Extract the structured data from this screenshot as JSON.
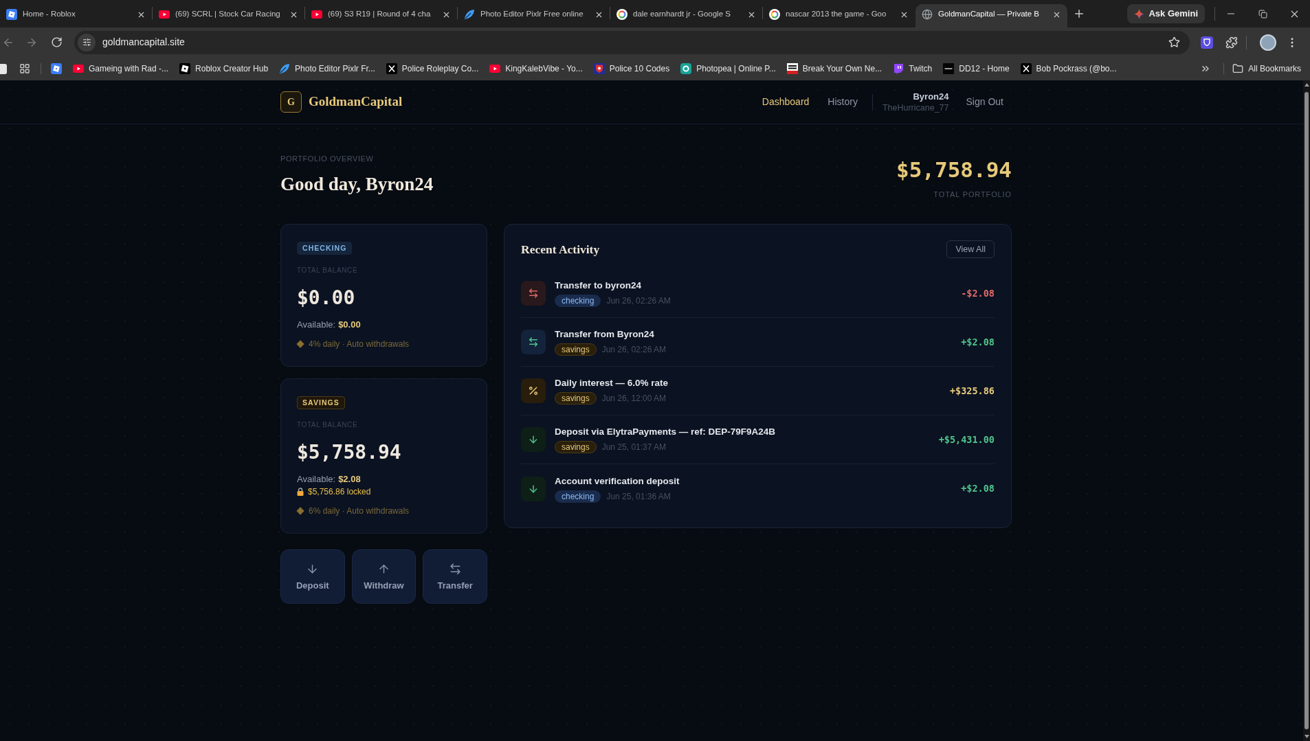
{
  "browser": {
    "tabs": [
      {
        "kind": "square",
        "title": "Home - Roblox",
        "selected": false
      },
      {
        "kind": "play",
        "title": "(69) SCRL | Stock Car Racing",
        "selected": false
      },
      {
        "kind": "play",
        "title": "(69) S3 R19 | Round of 4 cha",
        "selected": false
      },
      {
        "kind": "leaf",
        "title": "Photo Editor Pixlr Free online",
        "selected": false
      },
      {
        "kind": "ring",
        "title": "dale earnhardt jr - Google S",
        "selected": false
      },
      {
        "kind": "ring",
        "title": "nascar 2013 the game - Goo",
        "selected": false
      },
      {
        "kind": "globe",
        "title": "GoldmanCapital — Private B",
        "selected": true
      }
    ],
    "gemini_button": "Ask Gemini",
    "address": "goldmancapital.site",
    "bookmarks": [
      {
        "kind": "square"
      },
      {
        "kind": "play",
        "label": "Gameing with Rad -..."
      },
      {
        "kind": "tilted",
        "label": "Roblox Creator Hub"
      },
      {
        "kind": "leaf",
        "label": "Photo Editor Pixlr Fr..."
      },
      {
        "kind": "x",
        "label": "Police Roleplay Co..."
      },
      {
        "kind": "play",
        "label": "KingKalebVibe - Yo..."
      },
      {
        "kind": "emblem",
        "label": "Police 10 Codes"
      },
      {
        "kind": "ringtile",
        "label": "Photopea | Online P..."
      },
      {
        "kind": "news",
        "label": "Break Your Own Ne..."
      },
      {
        "kind": "bubble",
        "label": "Twitch"
      },
      {
        "kind": "tile",
        "label": "DD12 - Home"
      },
      {
        "kind": "x",
        "label": "Bob Pockrass (@bo..."
      }
    ],
    "all_bookmarks": "All Bookmarks"
  },
  "header": {
    "logo_letter": "G",
    "brand": "GoldmanCapital",
    "nav": [
      {
        "label": "Dashboard",
        "selected": true
      },
      {
        "label": "History",
        "selected": false
      }
    ],
    "user": {
      "name": "Byron24",
      "handle": "TheHurricane_77"
    },
    "sign_out": "Sign Out"
  },
  "overview": {
    "eyebrow": "PORTFOLIO OVERVIEW",
    "greeting": "Good day, Byron24",
    "total": "$5,758.94",
    "total_label": "TOTAL PORTFOLIO"
  },
  "accounts": [
    {
      "kind": "checking",
      "badge": "CHECKING",
      "balance_label": "TOTAL BALANCE",
      "balance": "$0.00",
      "available_label": "Available:",
      "available": "$0.00",
      "rate": "4% daily · Auto withdrawals"
    },
    {
      "kind": "savings",
      "badge": "SAVINGS",
      "balance_label": "TOTAL BALANCE",
      "balance": "$5,758.94",
      "available_label": "Available:",
      "available": "$2.08",
      "locked": "$5,756.86 locked",
      "rate": "6% daily · Auto withdrawals"
    }
  ],
  "actions": [
    {
      "kind": "deposit",
      "label": "Deposit"
    },
    {
      "kind": "withdraw",
      "label": "Withdraw"
    },
    {
      "kind": "transfer",
      "label": "Transfer"
    }
  ],
  "activity": {
    "title": "Recent Activity",
    "view_all": "View All",
    "items": [
      {
        "kind": "transfer_out",
        "title": "Transfer to byron24",
        "tag": {
          "kind": "checking",
          "label": "checking"
        },
        "time": "Jun 26, 02:26 AM",
        "amount": "-$2.08"
      },
      {
        "kind": "transfer_in",
        "title": "Transfer from Byron24",
        "tag": {
          "kind": "savings",
          "label": "savings"
        },
        "time": "Jun 26, 02:26 AM",
        "amount": "+$2.08"
      },
      {
        "kind": "interest",
        "title": "Daily interest — 6.0% rate",
        "tag": {
          "kind": "savings",
          "label": "savings"
        },
        "time": "Jun 26, 12:00 AM",
        "amount": "+$325.86"
      },
      {
        "kind": "deposit",
        "title": "Deposit via ElytraPayments — ref: DEP-79F9A24B",
        "tag": {
          "kind": "savings",
          "label": "savings"
        },
        "time": "Jun 25, 01:37 AM",
        "amount": "+$5,431.00"
      },
      {
        "kind": "deposit",
        "title": "Account verification deposit",
        "tag": {
          "kind": "checking",
          "label": "checking"
        },
        "time": "Jun 25, 01:36 AM",
        "amount": "+$2.08"
      }
    ]
  }
}
